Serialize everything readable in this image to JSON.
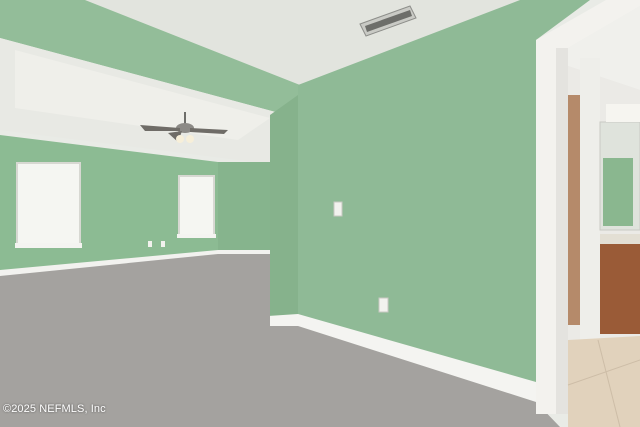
{
  "photo": {
    "subject": "empty-room-with-carpet-and-green-walls",
    "colors": {
      "wall_green": "#8fba96",
      "wall_green_shadow": "#7fa986",
      "ceiling": "#e6e8e2",
      "carpet": "#a3a19e",
      "baseboard": "#f4f4f1",
      "door_trim": "#f4f3ef",
      "tile": "#e3d3bd",
      "cabinet": "#9a5b37"
    },
    "icons": [
      "ceiling-fan-icon",
      "air-vent-icon",
      "window-icon",
      "light-switch-icon",
      "wall-outlet-icon"
    ]
  },
  "watermark": {
    "text": "©2025 NEFMLS, Inc"
  }
}
